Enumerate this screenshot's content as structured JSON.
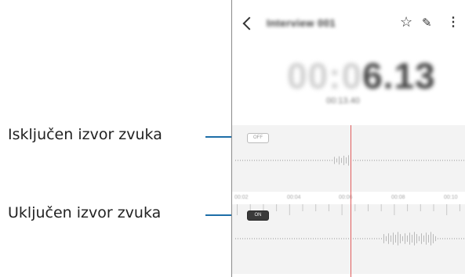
{
  "callouts": {
    "off_source": "Isključen izvor zvuka",
    "on_source": "Uključen izvor zvuka"
  },
  "app": {
    "title": "Interview 001",
    "back_icon": "back-arrow-icon",
    "actions": [
      "star-icon",
      "edit-pencil-icon",
      "more-vertical-icon"
    ],
    "timer_dim": "00:0",
    "timer_lit": "6.13",
    "subtime": "00:13.40"
  },
  "sources": {
    "off_label": "OFF",
    "on_label": "ON"
  },
  "timeline": {
    "labels": [
      "00:02",
      "00:04",
      "00:06",
      "00:08",
      "00:10"
    ]
  },
  "colors": {
    "leader": "#1d6ea8",
    "playhead": "#e05c5c",
    "panel": "#f3f3f3"
  }
}
